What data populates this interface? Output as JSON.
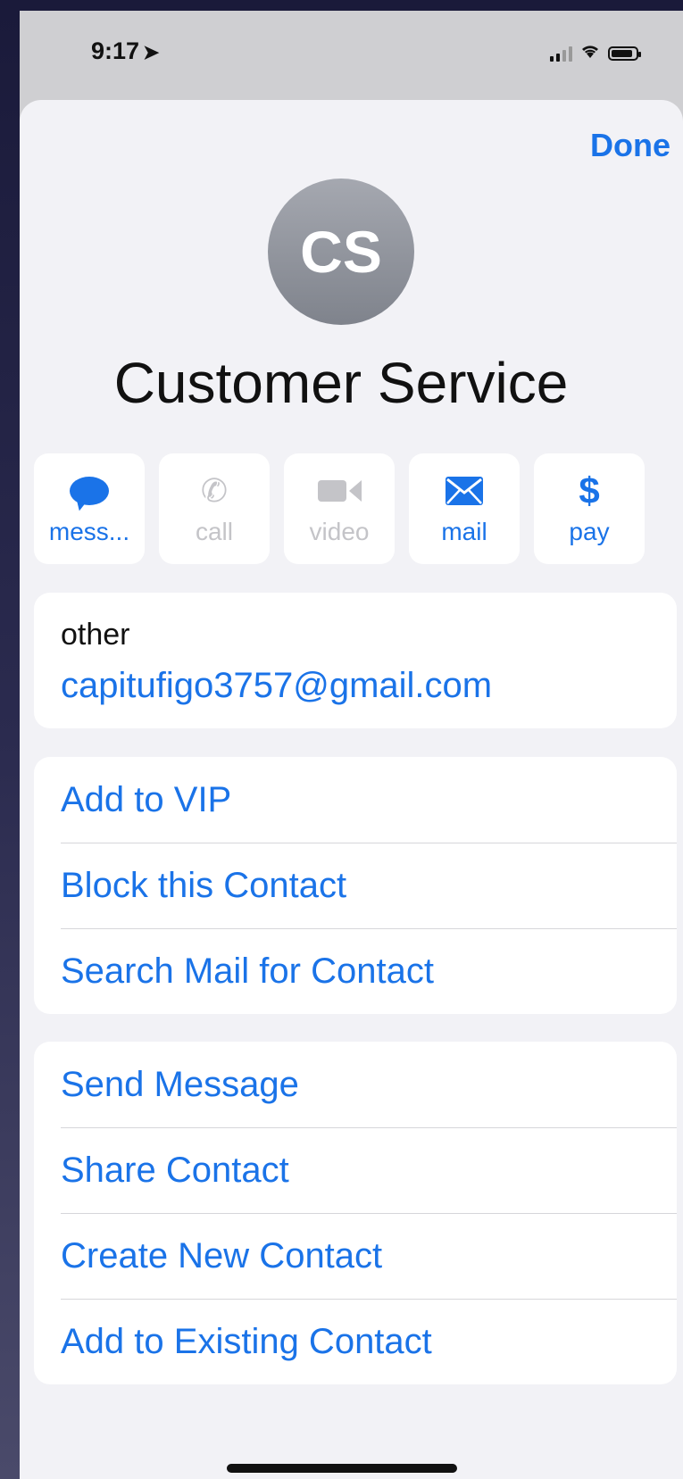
{
  "status_bar": {
    "time": "9:17",
    "location_icon": "location-arrow-icon"
  },
  "header": {
    "done_label": "Done"
  },
  "contact": {
    "initials": "CS",
    "name": "Customer Service"
  },
  "actions": [
    {
      "label": "mess...",
      "icon": "message-bubble-icon",
      "enabled": true
    },
    {
      "label": "call",
      "icon": "phone-icon",
      "enabled": false
    },
    {
      "label": "video",
      "icon": "video-camera-icon",
      "enabled": false
    },
    {
      "label": "mail",
      "icon": "envelope-icon",
      "enabled": true
    },
    {
      "label": "pay",
      "icon": "dollar-icon",
      "enabled": true
    }
  ],
  "email": {
    "label": "other",
    "value": "capitufigo3757@gmail.com"
  },
  "list1": [
    {
      "label": "Add to VIP"
    },
    {
      "label": "Block this Contact"
    },
    {
      "label": "Search Mail for Contact"
    }
  ],
  "list2": [
    {
      "label": "Send Message"
    },
    {
      "label": "Share Contact"
    },
    {
      "label": "Create New Contact"
    },
    {
      "label": "Add to Existing Contact"
    }
  ],
  "colors": {
    "accent": "#1a73e8",
    "disabled": "#c4c4c8",
    "sheet_bg": "#f2f2f6"
  }
}
